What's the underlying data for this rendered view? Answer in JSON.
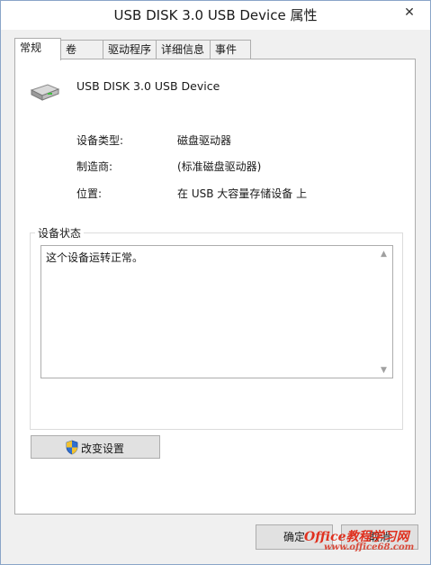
{
  "window": {
    "title": "USB DISK 3.0 USB Device 属性",
    "close_label": "✕"
  },
  "tabs": [
    {
      "label": "常规",
      "active": true
    },
    {
      "label": "卷",
      "active": false
    },
    {
      "label": "驱动程序",
      "active": false
    },
    {
      "label": "详细信息",
      "active": false
    },
    {
      "label": "事件",
      "active": false
    }
  ],
  "general": {
    "device_name": "USB DISK 3.0 USB Device",
    "icon": "usb-drive-icon",
    "properties": [
      {
        "label": "设备类型:",
        "value": "磁盘驱动器"
      },
      {
        "label": "制造商:",
        "value": "(标准磁盘驱动器)"
      },
      {
        "label": "位置:",
        "value": "在 USB 大容量存储设备 上"
      }
    ],
    "status": {
      "title": "设备状态",
      "text": "这个设备运转正常。"
    },
    "change_settings": {
      "label": "改变设置",
      "icon": "uac-shield-icon"
    }
  },
  "footer": {
    "ok_label": "确定",
    "cancel_label": "取消"
  },
  "watermark": {
    "line1": "Office教程学习网",
    "line2": "www.office68.com"
  },
  "colors": {
    "border": "#adadad",
    "button": "#e1e1e1",
    "window_border": "#8aa5c8",
    "watermark": "#e0301e"
  }
}
